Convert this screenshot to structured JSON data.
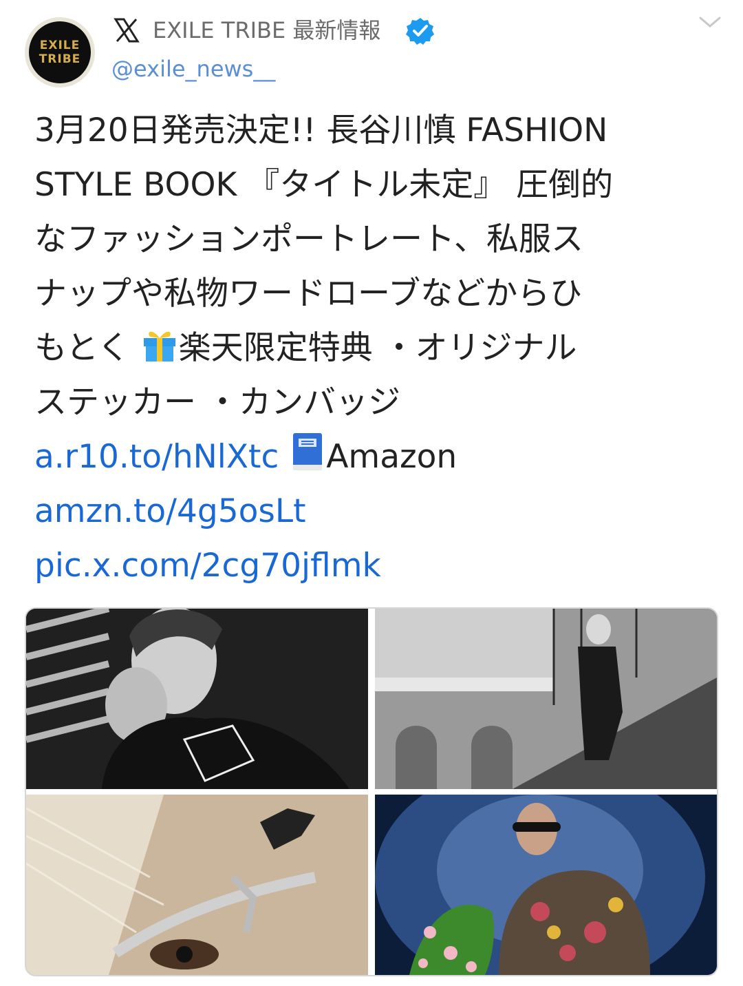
{
  "header": {
    "avatar_lines": [
      "EXILE",
      "TRIBE"
    ],
    "account_name": "EXILE TRIBE 最新情報",
    "handle": "@exile_news__"
  },
  "tweet": {
    "lines": [
      "3月20日発売決定!! 長谷川慎 FASHION",
      "STYLE BOOK 『タイトル未定』 圧倒的",
      "なファッションポートレート、私服ス",
      "ナップや私物ワードローブなどからひ"
    ],
    "line5_prefix": "もとく ",
    "line5_suffix": "楽天限定特典 ・オリジナル",
    "line6": "ステッカー ・カンバッジ",
    "link1": "a.r10.to/hNlXtc",
    "amazon_label": "Amazon",
    "link2": "amzn.to/4g5osLt",
    "link3": "pic.x.com/2cg70jflmk"
  },
  "icons": {
    "x_logo": "x-logo-icon",
    "verified": "verified-badge-icon",
    "chevron": "chevron-down-icon",
    "gift": "gift-emoji-icon",
    "book": "blue-book-emoji-icon"
  },
  "colors": {
    "link": "#1a68d4",
    "handle": "#5a8fd6",
    "verified": "#1d9bf0",
    "avatar_text": "#d6ad4c"
  }
}
